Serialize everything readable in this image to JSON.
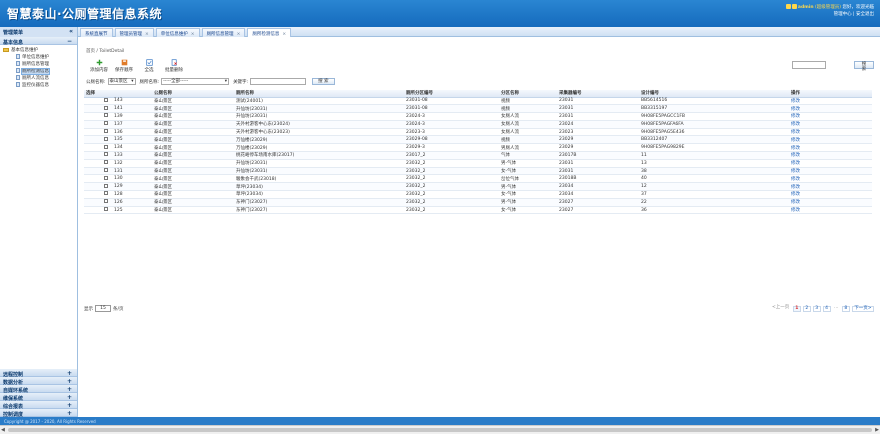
{
  "header": {
    "logo": "智慧泰山·公厕管理信息系统",
    "user_name": "admin",
    "user_role": "(超级管理员)",
    "greeting": "您好，欢迎光临",
    "links": "管理中心 | 安全退出"
  },
  "menu": {
    "title": "管理菜单",
    "collapse": "«",
    "section_basic": "基本信息",
    "section_basic_toggle": "−",
    "tree_root": "基本信息维护",
    "tree_items": [
      "单位信息维护",
      "厕所信息管理",
      "厕所检测信息",
      "厕所人流信息",
      "监控仪器信息"
    ],
    "bottom_sections": [
      {
        "label": "远程控制",
        "toggle": "+"
      },
      {
        "label": "数据分析",
        "toggle": "+"
      },
      {
        "label": "自媒环系统",
        "toggle": "+"
      },
      {
        "label": "维保系统",
        "toggle": "+"
      },
      {
        "label": "综合报表",
        "toggle": "+"
      },
      {
        "label": "控制调度",
        "toggle": "+"
      }
    ]
  },
  "tabs": [
    {
      "label": "系统直展节",
      "close": ""
    },
    {
      "label": "管理员管理",
      "close": "×"
    },
    {
      "label": "单位信息维护",
      "close": "×"
    },
    {
      "label": "厕所信息管理",
      "close": "×"
    },
    {
      "label": "厕所检测信息",
      "close": "×"
    }
  ],
  "breadcrumb": "首页 / ToiletDetail",
  "toolbar": {
    "add": "添加内容",
    "save": "保存顺序",
    "all": "全选",
    "batch_delete": "批量删除"
  },
  "filter": {
    "area_label": "公厕名称:",
    "area_value": "泰山景区",
    "toilet_label": "厕所名称:",
    "toilet_value": "-----全部-----",
    "keyword_label": "关键字:",
    "keyword_value": "",
    "search": "搜 索"
  },
  "right_search": {
    "value": "",
    "button": "搜 索"
  },
  "table": {
    "headers": [
      "选择",
      "",
      "公厕名称",
      "厕所名称",
      "厕所分区编号",
      "分区名称",
      "采集器编号",
      "设计编号",
      "操作"
    ],
    "rows": [
      [
        "143",
        "泰山景区",
        "测试(24001)",
        "23031-08",
        "视频",
        "23031",
        "BB5614516",
        "修改"
      ],
      [
        "141",
        "泰山景区",
        "升仙坊(23031)",
        "23031-08",
        "视频",
        "23031",
        "BB3315197",
        "修改"
      ],
      [
        "139",
        "泰山景区",
        "升仙坊(23031)",
        "23024-3",
        "女厕人流",
        "23031",
        "9H08FE5PAGCC1FB",
        "修改"
      ],
      [
        "137",
        "泰山景区",
        "天外村游客中心东(23024)",
        "23024-3",
        "女厕人流",
        "23024",
        "9H08FE5PAGFA6FA",
        "修改"
      ],
      [
        "136",
        "泰山景区",
        "天外村游客中心东(23023)",
        "23023-3",
        "女厕人流",
        "23023",
        "9H08FE5PAG5E436",
        "修改"
      ],
      [
        "135",
        "泰山景区",
        "万仙楼(23029)",
        "23029-08",
        "视频",
        "23029",
        "BB3312407",
        "修改"
      ],
      [
        "134",
        "泰山景区",
        "万仙楼(23029)",
        "23029-3",
        "男厕人流",
        "23029",
        "9H08FE5PAG9829E",
        "修改"
      ],
      [
        "133",
        "泰山景区",
        "桃花峪停车场南水库(23017)",
        "23017_2",
        "气体",
        "23017B",
        "11",
        "修改"
      ],
      [
        "132",
        "泰山景区",
        "升仙坊(23031)",
        "23032_2",
        "男-气体",
        "23031",
        "13",
        "修改"
      ],
      [
        "131",
        "泰山景区",
        "升仙坊(23031)",
        "23032_2",
        "女-气体",
        "23031",
        "38",
        "修改"
      ],
      [
        "130",
        "泰山景区",
        "駿象会千武(23018)",
        "23032_2",
        "岔位气体",
        "23018B",
        "40",
        "修改"
      ],
      [
        "129",
        "泰山景区",
        "草坪(23034)",
        "23032_2",
        "男-气体",
        "23034",
        "12",
        "修改"
      ],
      [
        "128",
        "泰山景区",
        "草坪(23034)",
        "23032_2",
        "女-气体",
        "23034",
        "37",
        "修改"
      ],
      [
        "126",
        "泰山景区",
        "东神门(23027)",
        "23032_2",
        "男-气体",
        "23027",
        "22",
        "修改"
      ],
      [
        "125",
        "泰山景区",
        "东神门(23027)",
        "23032_2",
        "女-气体",
        "23027",
        "36",
        "修改"
      ]
    ]
  },
  "pagination": {
    "size_label_pre": "显示",
    "size_value": "15",
    "size_label_post": "条/页",
    "prev": "<上一页",
    "pages": [
      "1",
      "2",
      "3",
      "4"
    ],
    "ellipsis": "...",
    "last": "8",
    "next": "下一页>"
  },
  "footer": "Copyright @ 2017 - 2020, All Rights Reserved"
}
